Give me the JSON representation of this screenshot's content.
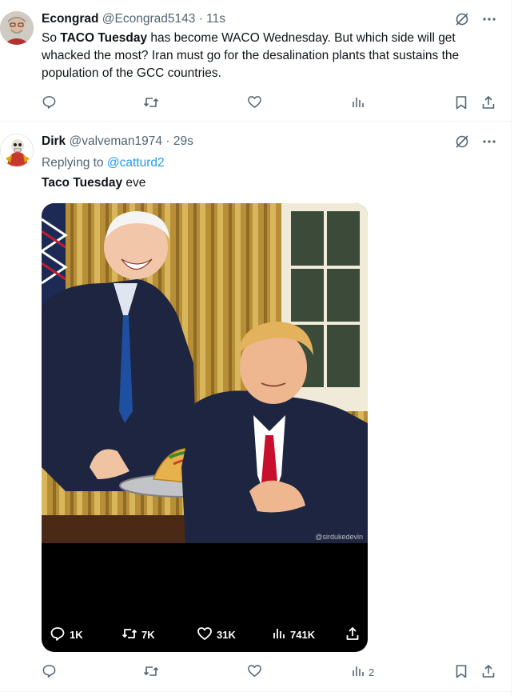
{
  "tweets": [
    {
      "author": {
        "name": "Econgrad",
        "handle": "@Econgrad5143",
        "separator": "·",
        "time": "11s"
      },
      "text_parts": [
        {
          "text": "So ",
          "bold": false
        },
        {
          "text": "TACO Tuesday",
          "bold": true
        },
        {
          "text": " has become WACO Wednesday. But which side will get whacked the most? Iran must go for the desalination plants that sustains the population of the GCC countries.",
          "bold": false
        }
      ],
      "actions": {
        "reply_count": "",
        "retweet_count": "",
        "like_count": "",
        "views_count": ""
      },
      "icons": [
        "grok-icon",
        "more-icon",
        "reply-icon",
        "retweet-icon",
        "like-icon",
        "views-icon",
        "bookmark-icon",
        "share-icon"
      ]
    },
    {
      "author": {
        "name": "Dirk",
        "handle": "@valveman1974",
        "separator": "·",
        "time": "29s"
      },
      "replying_label": "Replying to",
      "replying_to": "@catturd2",
      "text_parts": [
        {
          "text": "Taco Tuesday",
          "bold": true
        },
        {
          "text": " eve",
          "bold": false
        }
      ],
      "media": {
        "watermark": "@sirdukedevin",
        "stats": {
          "replies": "1K",
          "retweets": "7K",
          "likes": "31K",
          "views": "741K"
        }
      },
      "actions": {
        "reply_count": "",
        "retweet_count": "",
        "like_count": "",
        "views_count": "2"
      }
    }
  ],
  "colors": {
    "text": "#0f1419",
    "secondary": "#536471",
    "link": "#1d9bf0",
    "border": "#eff3f4"
  }
}
